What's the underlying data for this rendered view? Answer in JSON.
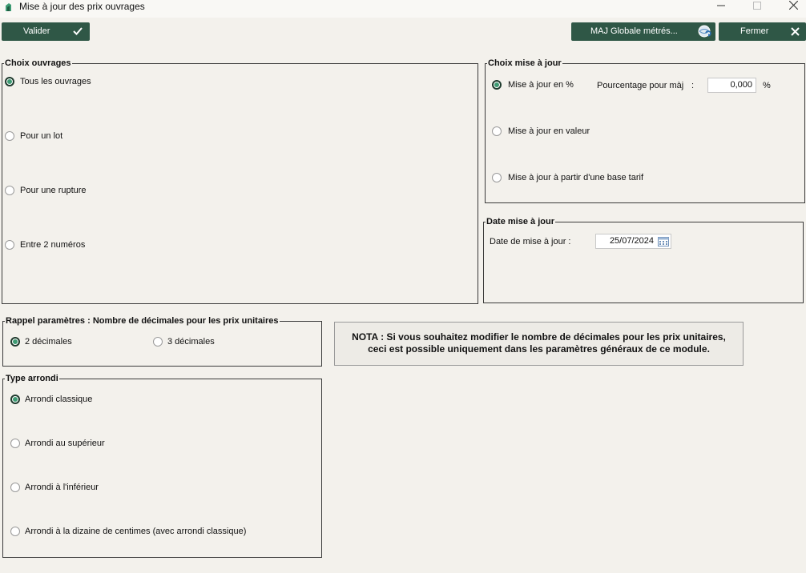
{
  "window": {
    "title": "Mise à jour des prix ouvrages"
  },
  "toolbar": {
    "validate_label": "Valider",
    "maj_globale_label": "MAJ Globale métrés...",
    "close_label": "Fermer"
  },
  "choix_ouvrages": {
    "legend": "Choix ouvrages",
    "options": [
      "Tous les ouvrages",
      "Pour un lot",
      "Pour une rupture",
      "Entre 2 numéros"
    ],
    "selected": "Tous les ouvrages"
  },
  "choix_maj": {
    "legend": "Choix mise à jour",
    "options": [
      "Mise à jour en %",
      "Mise à jour en valeur",
      "Mise à jour à partir d'une base tarif"
    ],
    "selected": "Mise à jour en %",
    "pct_label": "Pourcentage pour màj",
    "colon": ":",
    "pct_value": "0,000",
    "pct_unit": "%"
  },
  "date_maj": {
    "legend": "Date mise à jour",
    "label": "Date de mise à jour :",
    "value": "25/07/2024"
  },
  "rappel": {
    "legend": "Rappel paramètres : Nombre de décimales pour les prix unitaires",
    "options": [
      "2 décimales",
      "3 décimales"
    ],
    "selected": "2 décimales"
  },
  "note": {
    "line1": "NOTA : Si vous souhaitez modifier le nombre de décimales pour les prix unitaires,",
    "line2": "ceci est possible uniquement dans les paramètres généraux de ce module."
  },
  "type_arrondi": {
    "legend": "Type arrondi",
    "options": [
      "Arrondi classique",
      "Arrondi au supérieur",
      "Arrondi à l'inférieur",
      "Arrondi à la dizaine de centimes (avec arrondi classique)"
    ],
    "selected": "Arrondi classique"
  },
  "colors": {
    "button_bg": "#2f5746",
    "radio_selected": "#3d9b73",
    "window_bg": "#f3f1ec"
  },
  "icons": [
    "app-icon",
    "check-icon",
    "refresh-globe-icon",
    "close-icon",
    "minimize-icon",
    "maximize-icon",
    "calendar-icon"
  ]
}
